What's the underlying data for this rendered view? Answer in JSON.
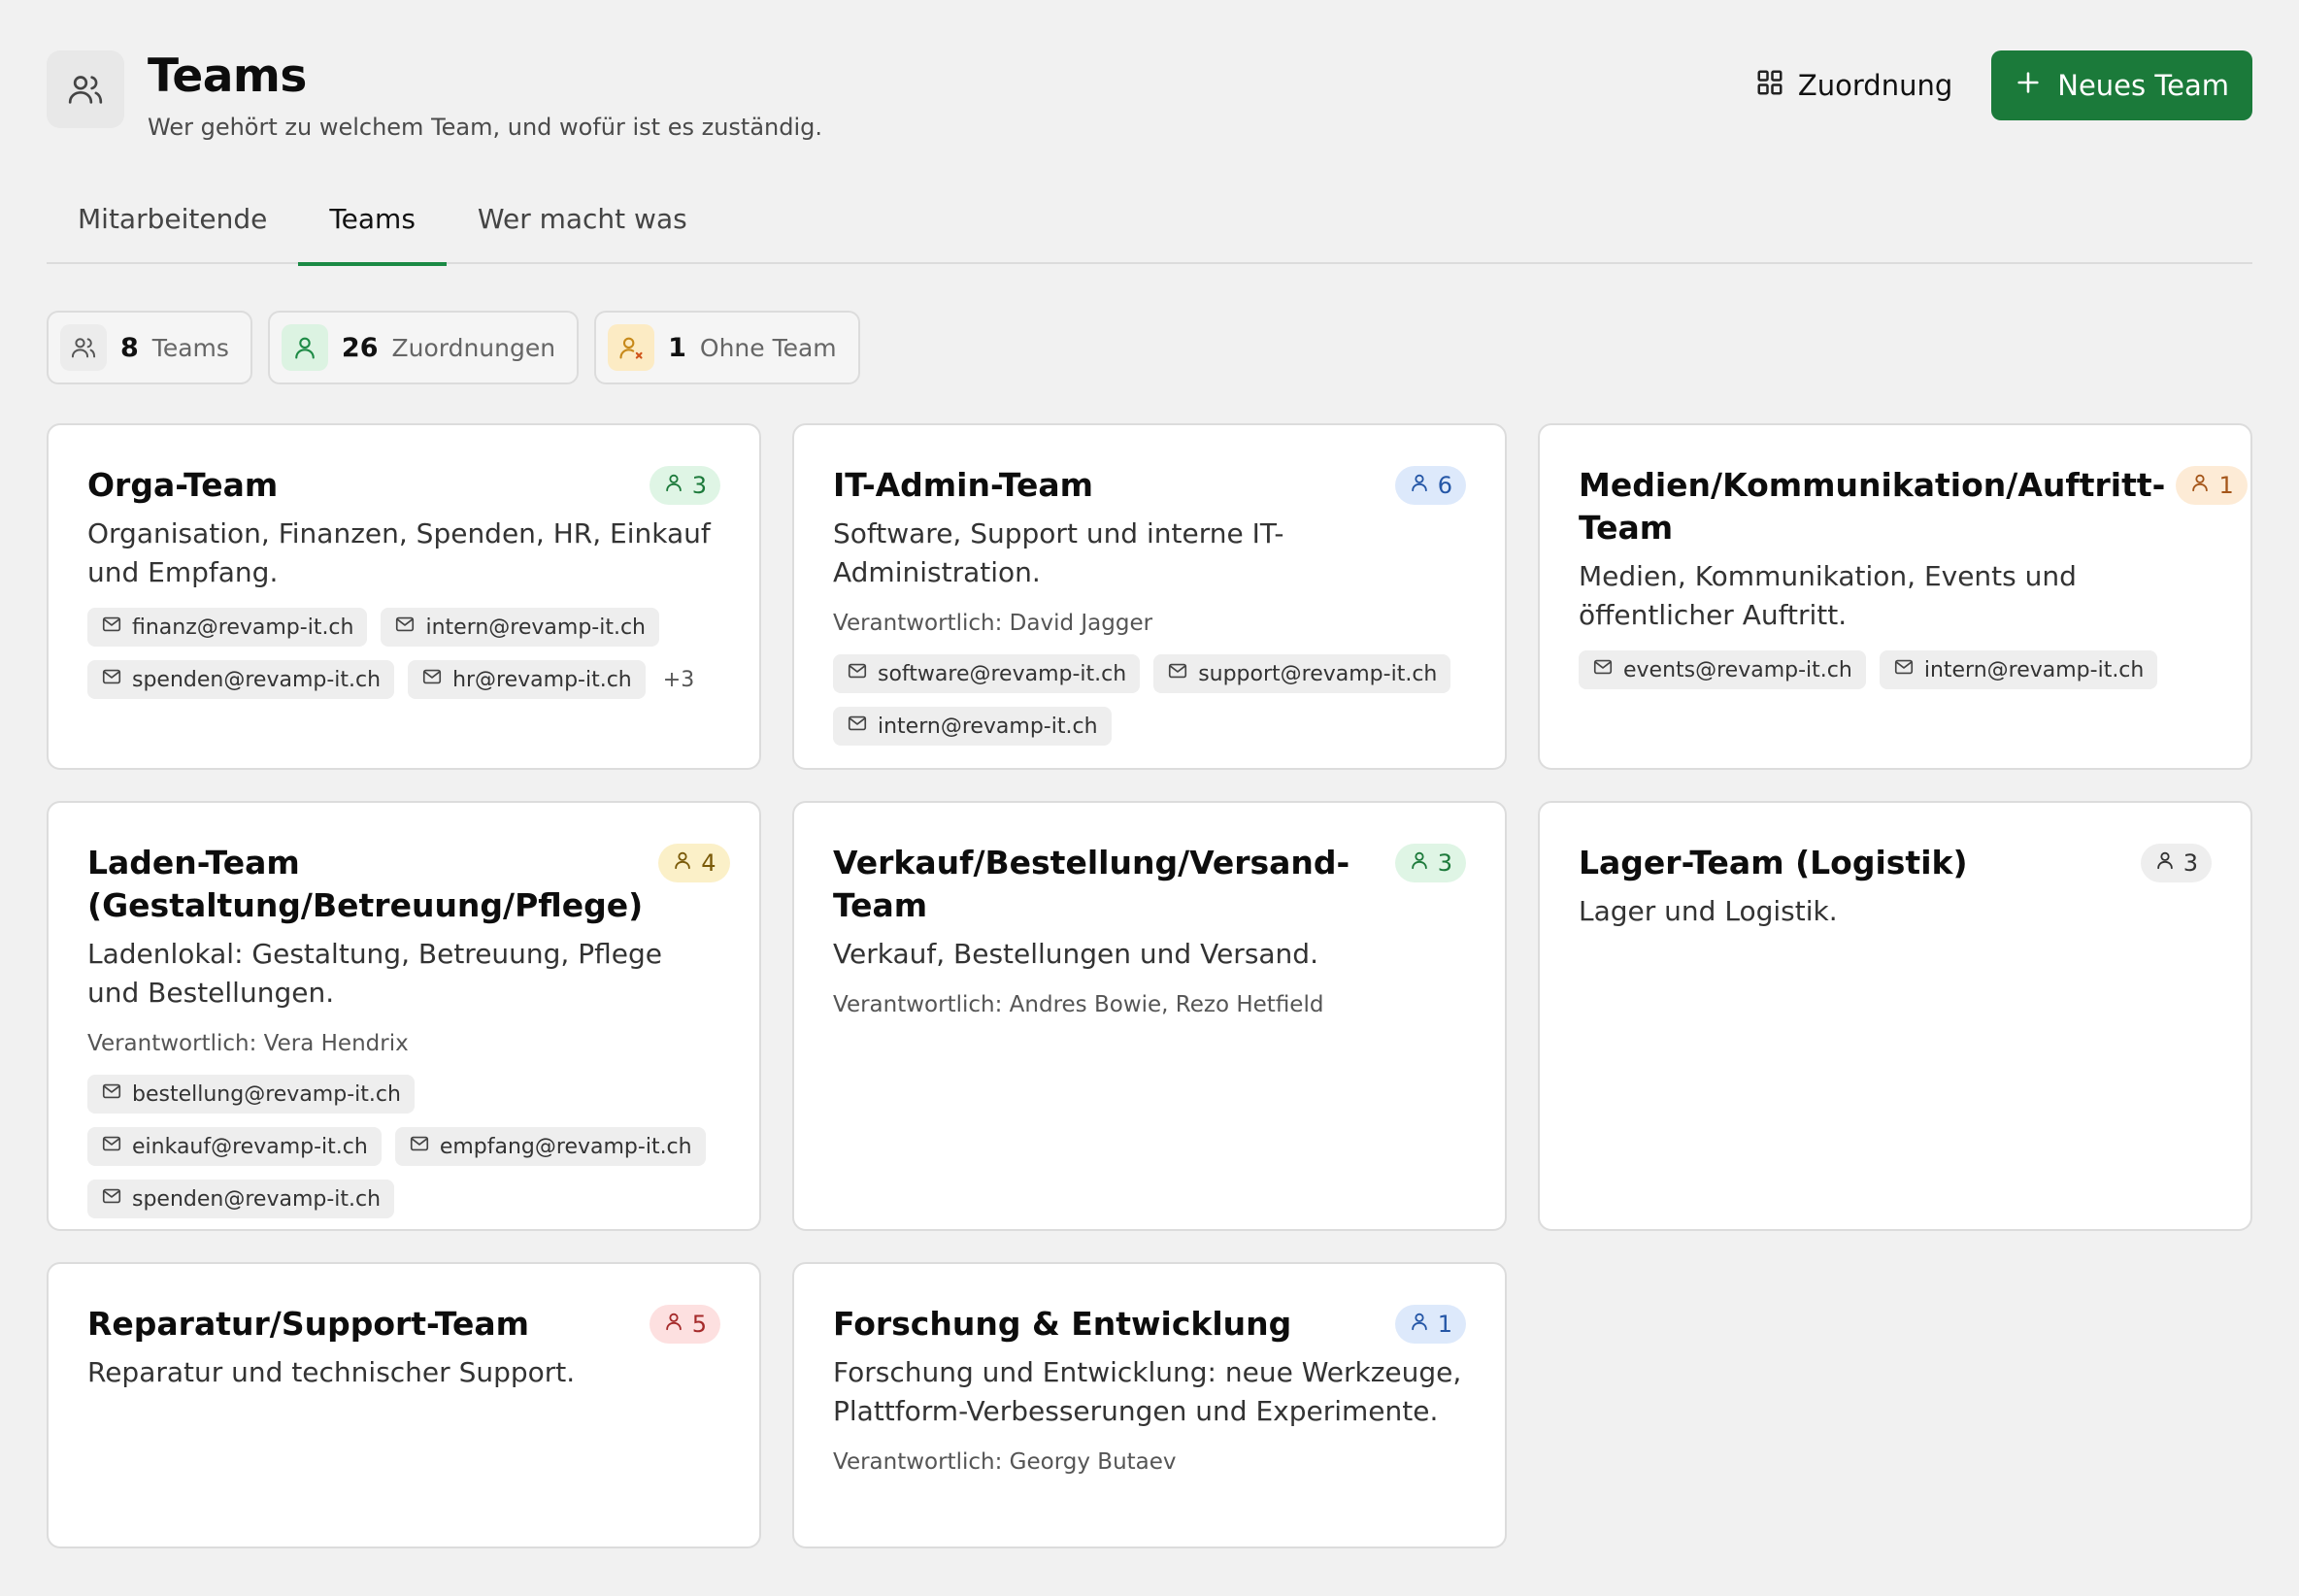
{
  "header": {
    "title": "Teams",
    "subtitle": "Wer gehört zu welchem Team, und wofür ist es zuständig.",
    "assign_label": "Zuordnung",
    "new_team_label": "Neues Team"
  },
  "tabs": [
    {
      "label": "Mitarbeitende",
      "active": false
    },
    {
      "label": "Teams",
      "active": true
    },
    {
      "label": "Wer macht was",
      "active": false
    }
  ],
  "stats": [
    {
      "value": "8",
      "label": "Teams",
      "icon": "users-icon"
    },
    {
      "value": "26",
      "label": "Zuordnungen",
      "icon": "user-check-icon"
    },
    {
      "value": "1",
      "label": "Ohne Team",
      "icon": "user-x-icon"
    }
  ],
  "responsible_prefix": "Verantwortlich:",
  "colors": {
    "primary": "#1b7a3a",
    "tab_underline": "#1b8a45",
    "badge_green_bg": "#dff5e5",
    "badge_green_fg": "#1d7a3b",
    "badge_blue_bg": "#dde9fb",
    "badge_blue_fg": "#2456a6",
    "badge_orange_bg": "#fdebd6",
    "badge_orange_fg": "#a5561a",
    "badge_yellow_bg": "#fbf0c8",
    "badge_yellow_fg": "#7a5a08",
    "badge_gray_bg": "#eeeeee",
    "badge_gray_fg": "#333333",
    "badge_red_bg": "#fde0e0",
    "badge_red_fg": "#a52a2a"
  },
  "teams": [
    {
      "name": "Orga-Team",
      "count": "3",
      "badge": "green",
      "description": "Organisation, Finanzen, Spenden, HR, Einkauf und Empfang.",
      "responsible": "",
      "emails": [
        "finanz@revamp-it.ch",
        "intern@revamp-it.ch",
        "spenden@revamp-it.ch",
        "hr@revamp-it.ch"
      ],
      "more": "+3"
    },
    {
      "name": "IT-Admin-Team",
      "count": "6",
      "badge": "blue",
      "description": "Software, Support und interne IT-Administration.",
      "responsible": "David Jagger",
      "emails": [
        "software@revamp-it.ch",
        "support@revamp-it.ch",
        "intern@revamp-it.ch"
      ],
      "more": ""
    },
    {
      "name": "Medien/Kommunikation/Auftritt-Team",
      "count": "1",
      "badge": "orange",
      "description": "Medien, Kommunikation, Events und öffentlicher Auftritt.",
      "responsible": "",
      "emails": [
        "events@revamp-it.ch",
        "intern@revamp-it.ch"
      ],
      "more": ""
    },
    {
      "name": "Laden-Team (Gestaltung/Betreuung/Pflege)",
      "count": "4",
      "badge": "yellow",
      "description": "Ladenlokal: Gestaltung, Betreuung, Pflege und Bestellungen.",
      "responsible": "Vera Hendrix",
      "emails": [
        "bestellung@revamp-it.ch",
        "einkauf@revamp-it.ch",
        "empfang@revamp-it.ch",
        "spenden@revamp-it.ch"
      ],
      "more": ""
    },
    {
      "name": "Verkauf/Bestellung/Versand-Team",
      "count": "3",
      "badge": "green",
      "description": "Verkauf, Bestellungen und Versand.",
      "responsible": "Andres Bowie, Rezo Hetfield",
      "emails": [],
      "more": ""
    },
    {
      "name": "Lager-Team (Logistik)",
      "count": "3",
      "badge": "gray",
      "description": "Lager und Logistik.",
      "responsible": "",
      "emails": [],
      "more": ""
    },
    {
      "name": "Reparatur/Support-Team",
      "count": "5",
      "badge": "red",
      "description": "Reparatur und technischer Support.",
      "responsible": "",
      "emails": [],
      "more": ""
    },
    {
      "name": "Forschung & Entwicklung",
      "count": "1",
      "badge": "blue",
      "description": "Forschung und Entwicklung: neue Werkzeuge, Plattform-Verbesserungen und Experimente.",
      "responsible": "Georgy Butaev",
      "emails": [],
      "more": ""
    }
  ]
}
